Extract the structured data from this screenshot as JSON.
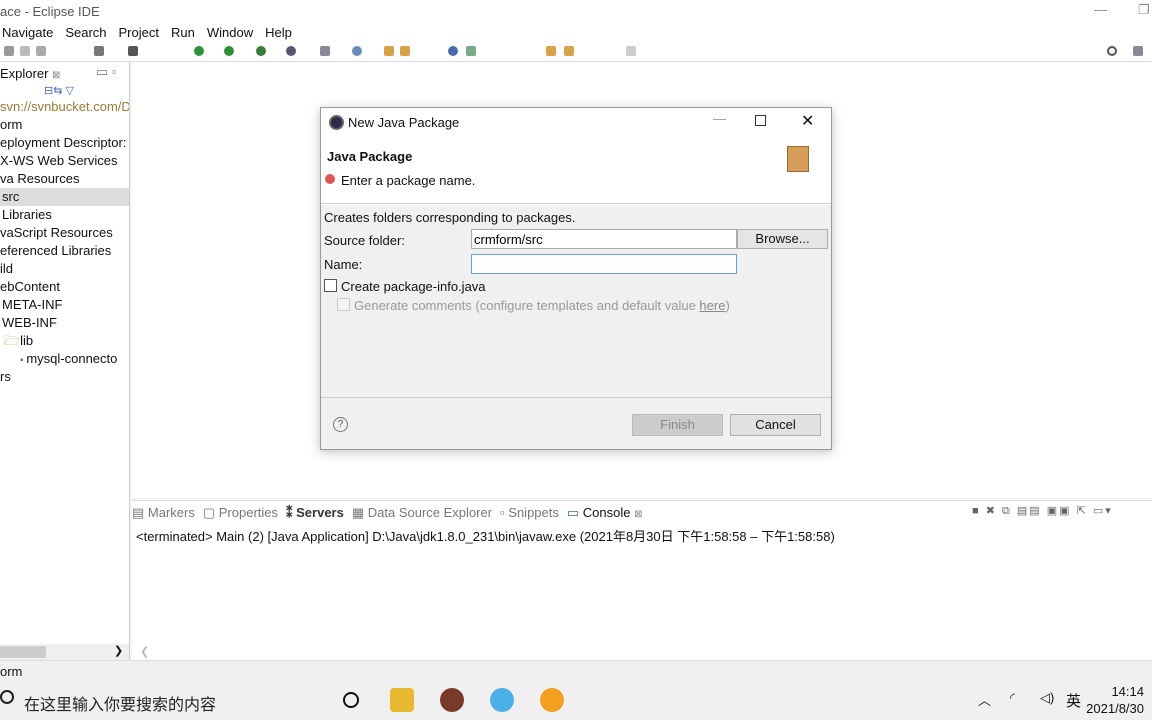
{
  "app": {
    "title": "ace - Eclipse IDE"
  },
  "menu": [
    "Navigate",
    "Search",
    "Project",
    "Run",
    "Window",
    "Help"
  ],
  "explorer": {
    "tab_label": "Explorer",
    "tree": [
      "svn://svnbucket.com/D",
      "orm",
      "eployment Descriptor:",
      "X-WS Web Services",
      "va Resources",
      "src",
      "Libraries",
      "vaScript Resources",
      "eferenced Libraries",
      "ild",
      "ebContent",
      "META-INF",
      "WEB-INF",
      "lib",
      "mysql-connecto",
      "rs"
    ]
  },
  "dialog": {
    "title": "New Java Package",
    "heading": "Java Package",
    "error_message": "Enter a package name.",
    "description": "Creates folders corresponding to packages.",
    "source_folder_label": "Source folder:",
    "source_folder_value": "crmform/src",
    "browse_label": "Browse...",
    "name_label": "Name:",
    "name_value": "",
    "create_pkg_info_label": "Create package-info.java",
    "generate_comments_label": "Generate comments (configure templates and default value ",
    "generate_comments_link": "here",
    "generate_comments_suffix": ")",
    "finish_label": "Finish",
    "cancel_label": "Cancel",
    "help_symbol": "?"
  },
  "bottom_panel": {
    "tabs": [
      "Markers",
      "Properties",
      "Servers",
      "Data Source Explorer",
      "Snippets",
      "Console"
    ],
    "active_tab": "Console",
    "console_line": "<terminated> Main (2) [Java Application] D:\\Java\\jdk1.8.0_231\\bin\\javaw.exe  (2021年8月30日 下午1:58:58 – 下午1:58:58)"
  },
  "status": {
    "text": "orm"
  },
  "taskbar": {
    "search_placeholder": "在这里输入你要搜索的内容",
    "ime": "英",
    "time": "14:14",
    "date": "2021/8/30"
  }
}
